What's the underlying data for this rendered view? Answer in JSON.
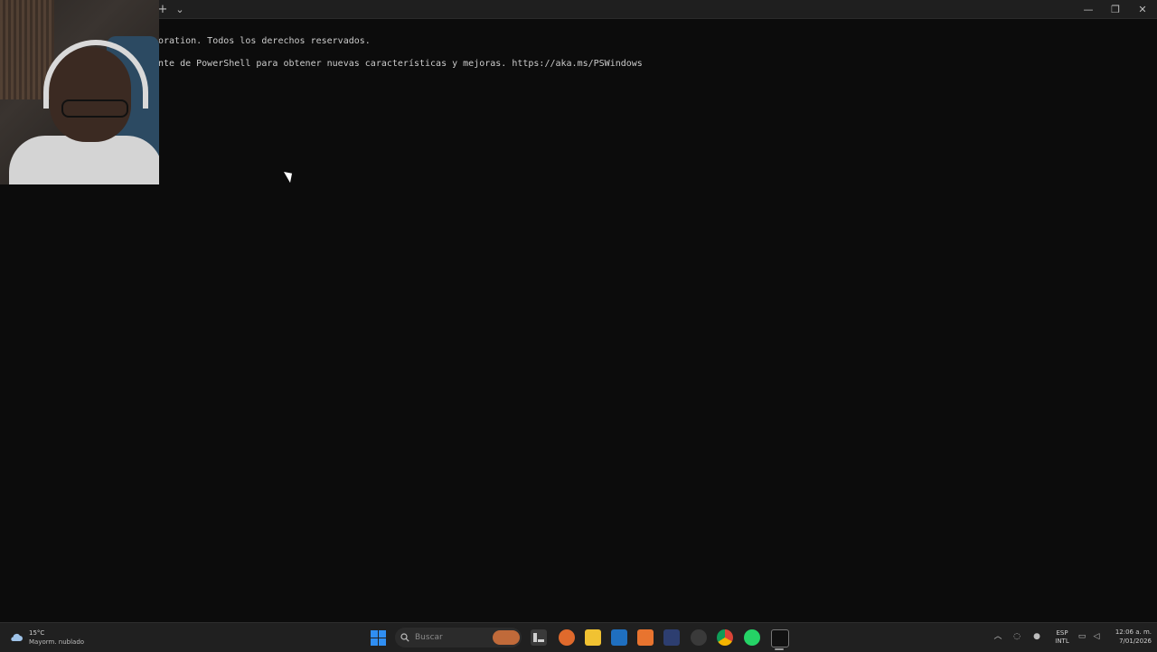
{
  "window": {
    "new_tab_glyph": "+",
    "dropdown_glyph": "⌄",
    "minimize_glyph": "—",
    "maximize_glyph": "❐",
    "close_glyph": "✕"
  },
  "terminal": {
    "lines": [
      "oration. Todos los derechos reservados.",
      "nte de PowerShell para obtener nuevas características y mejoras. https://aka.ms/PSWindows"
    ]
  },
  "taskbar": {
    "weather": {
      "temp": "15°C",
      "desc": "Mayorm. nublado"
    },
    "search": {
      "placeholder": "Buscar"
    },
    "tray": {
      "language": "ESP",
      "keyboard": "INTL",
      "time": "12:06 a. m.",
      "date": "7/01/2026"
    }
  },
  "colors": {
    "terminal_bg": "#0c0c0c",
    "terminal_text": "#cccccc",
    "taskbar_bg": "#202020",
    "accent_blue": "#2f8ef2"
  }
}
